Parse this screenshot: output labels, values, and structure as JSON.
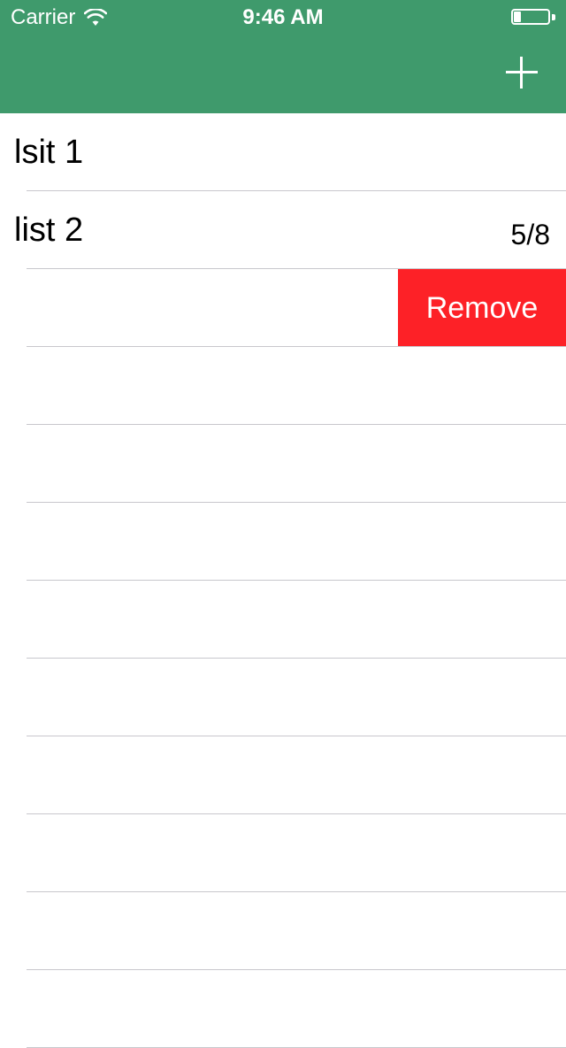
{
  "status_bar": {
    "carrier": "Carrier",
    "time": "9:46 AM",
    "battery_level": 0.2
  },
  "nav": {
    "background": "#3f9a6c",
    "add_icon": "plus-icon"
  },
  "lists": [
    {
      "title": "lsit 1",
      "detail": ""
    },
    {
      "title": "list 2",
      "detail": "5/8"
    },
    {
      "title": "",
      "detail": "",
      "swipe_action": "Remove"
    }
  ],
  "colors": {
    "separator": "#c8c7cc",
    "remove": "#fd2127"
  }
}
